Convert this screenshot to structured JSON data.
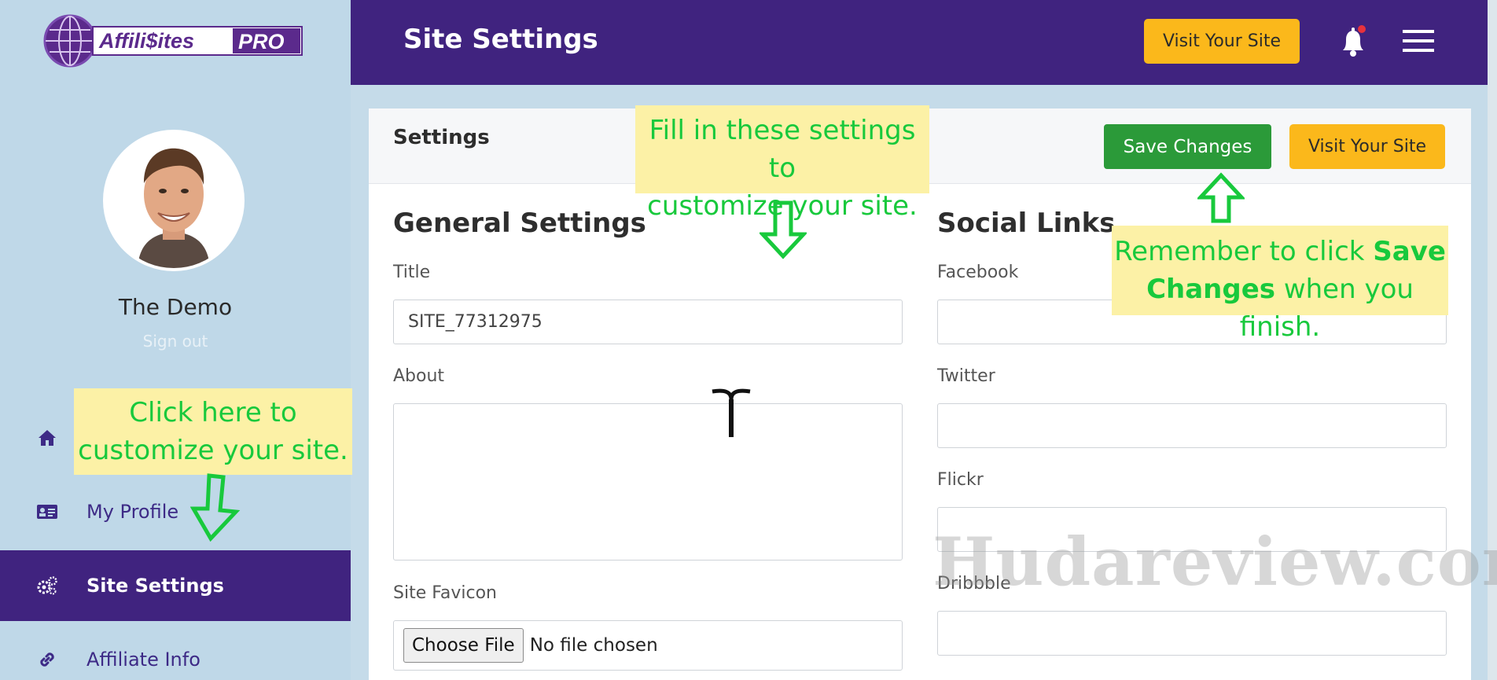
{
  "brand": {
    "name_part1": "Affili",
    "name_part2": "$ites",
    "name_badge": "PRO"
  },
  "user": {
    "name": "The Demo",
    "sign_out": "Sign out"
  },
  "sidebar": {
    "items": [
      {
        "label": "",
        "icon": "home-icon"
      },
      {
        "label": "My Profile",
        "icon": "id-card-icon"
      },
      {
        "label": "Site Settings",
        "icon": "gears-icon",
        "active": true
      },
      {
        "label": "Affiliate Info",
        "icon": "link-icon"
      }
    ]
  },
  "header": {
    "title": "Site Settings",
    "visit_button": "Visit Your Site"
  },
  "settings_card": {
    "title": "Settings",
    "save_button": "Save Changes",
    "visit_button": "Visit Your Site"
  },
  "general": {
    "heading": "General Settings",
    "title_label": "Title",
    "title_value": "SITE_77312975",
    "about_label": "About",
    "about_value": "",
    "favicon_label": "Site Favicon",
    "file_button": "Choose File",
    "file_status": "No file chosen"
  },
  "social": {
    "heading": "Social Links",
    "facebook_label": "Facebook",
    "twitter_label": "Twitter",
    "flickr_label": "Flickr",
    "dribbble_label": "Dribbble"
  },
  "annotations": {
    "fill_line1": "Fill in these settings to",
    "fill_line2": "customize your site.",
    "click_line1": "Click here to",
    "click_line2": "customize your site.",
    "save_pre": "Remember to click ",
    "save_bold1": "Save",
    "save_bold2": "Changes",
    "save_post": " when you finish."
  },
  "watermark": "Hudareview.com",
  "colors": {
    "brand_purple": "#40237f",
    "sidebar_bg": "#bfd8e8",
    "accent_yellow": "#fbb81b",
    "save_green": "#2b9a39",
    "note_bg": "#fcf1a6",
    "note_text": "#18c93c"
  }
}
